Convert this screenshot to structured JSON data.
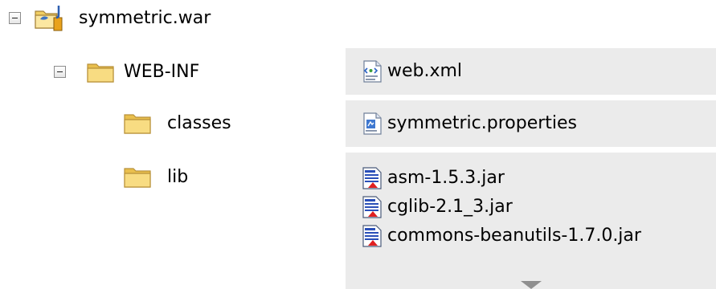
{
  "tree": {
    "root": {
      "label": "symmetric.war",
      "icon": "war-archive-icon",
      "expanded": true
    },
    "web_inf": {
      "label": "WEB-INF",
      "icon": "folder-open-icon",
      "expanded": true
    },
    "classes": {
      "label": "classes",
      "icon": "folder-icon"
    },
    "lib": {
      "label": "lib",
      "icon": "folder-icon"
    }
  },
  "files": {
    "web_inf_files": [
      {
        "name": "web.xml",
        "icon": "xml-file-icon"
      }
    ],
    "classes_files": [
      {
        "name": "symmetric.properties",
        "icon": "properties-file-icon"
      }
    ],
    "lib_files": [
      {
        "name": "asm-1.5.3.jar",
        "icon": "jar-file-icon"
      },
      {
        "name": "cglib-2.1_3.jar",
        "icon": "jar-file-icon"
      },
      {
        "name": "commons-beanutils-1.7.0.jar",
        "icon": "jar-file-icon"
      }
    ],
    "more_indicator_icon": "chevron-down-icon"
  },
  "colors": {
    "panel_background": "#ebebeb",
    "folder_yellow": "#f5d46a",
    "folder_outline": "#b8913a"
  }
}
